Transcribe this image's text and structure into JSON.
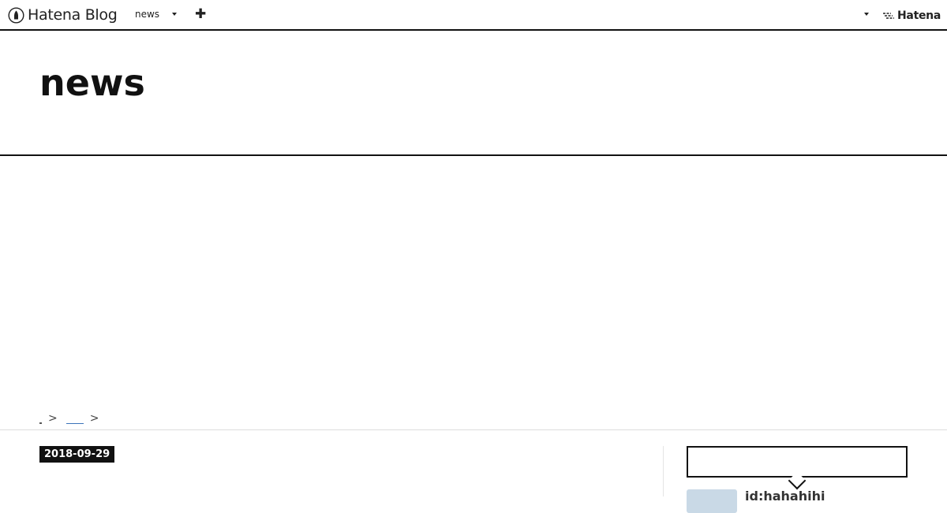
{
  "global_header": {
    "logo_text": "Hatena Blog",
    "blog_selector_label": "news",
    "add_button_label": "✚",
    "brand_text": "Hatena"
  },
  "blog": {
    "title": "news"
  },
  "breadcrumb": {
    "separator_1": ">",
    "separator_2": ">"
  },
  "entry": {
    "date": "2018-09-29"
  },
  "sidebar": {
    "profile": {
      "user_id": "id:hahahihi"
    }
  },
  "colors": {
    "accent_dark": "#111111",
    "link": "#3b73b9",
    "avatar_bg": "#c9d9e6"
  }
}
